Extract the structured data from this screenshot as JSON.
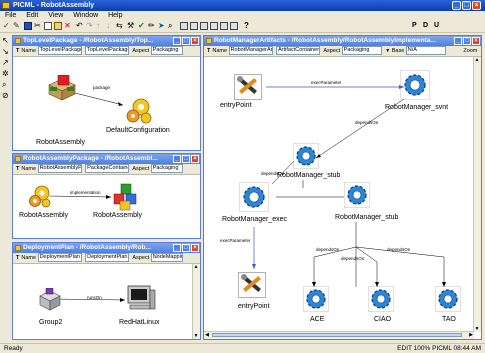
{
  "app": {
    "title": "PICML - RobotAssembly"
  },
  "menu": [
    "File",
    "Edit",
    "View",
    "Window",
    "Help"
  ],
  "toolbar_right": [
    "P",
    "D",
    "U"
  ],
  "win_top": {
    "title": "TopLevelPackage - /RobotAssembly/Top...",
    "name_label": "Name",
    "name_value": "TopLevelPackage",
    "kind_value": "TopLevelPackageC",
    "aspect_label": "Aspect",
    "aspect_value": "Packaging",
    "nodes": {
      "robot": "RobotAssembly",
      "config": "DefaultConfiguration"
    },
    "conn": "package"
  },
  "win_pkg": {
    "title": "RobotAssemblyPackage - /RobotAssembl...",
    "name_label": "Name",
    "name_value": "RobotAssemblyPack",
    "kind_value": "PackageContainer",
    "aspect_label": "Aspect",
    "aspect_value": "Packaging",
    "nodes": {
      "left": "RobotAssembly",
      "right": "RobotAssembly"
    },
    "conn": "implementation"
  },
  "win_dep": {
    "title": "DeploymentPlan - /RobotAssembly/Rob...",
    "name_label": "Name",
    "name_value": "DeploymentPlan",
    "kind_value": "DeploymentPlan",
    "aspect_label": "Aspect",
    "aspect_value": "NodeMapping",
    "nodes": {
      "group": "Group2",
      "host": "RedHatLinux"
    },
    "conn": "runsOn"
  },
  "win_main": {
    "title": "RobotManagerArtifacts - /RobotAssembly/RobotAssemblyImplementa...",
    "name_label": "Name",
    "name_value": "RobotManagerArtifa",
    "kind_value": "ArtifactContainer",
    "aspect_label": "Aspect",
    "aspect_value": "Packaging",
    "base_label": "Base",
    "base_value": "N/A",
    "zoom_label": "Zoom",
    "nodes": {
      "entry1": "entryPoint",
      "svnt": "RobotManager_svnt",
      "stub1": "RobotManager_stub",
      "exec": "RobotManager_exec",
      "stub2": "RobotManager_stub",
      "entry2": "entryPoint",
      "ace": "ACE",
      "ciao": "CIAO",
      "tao": "TAO"
    },
    "conns": {
      "exec_param_top": "execParameter",
      "depends_top": "dependsOn",
      "depends_mid": "dependsOn",
      "exec_param_bottom": "execParameter",
      "depends_ace": "dependsOn",
      "depends_ciao": "dependsOn",
      "depends_tao": "dependsOn"
    }
  },
  "status": {
    "left": "Ready",
    "right": "EDIT  100%  PICML  08:44  AM"
  },
  "colors": {
    "title": "#0a3eb0",
    "gear": "#2b86d6",
    "wintitle": "#5080e0"
  }
}
